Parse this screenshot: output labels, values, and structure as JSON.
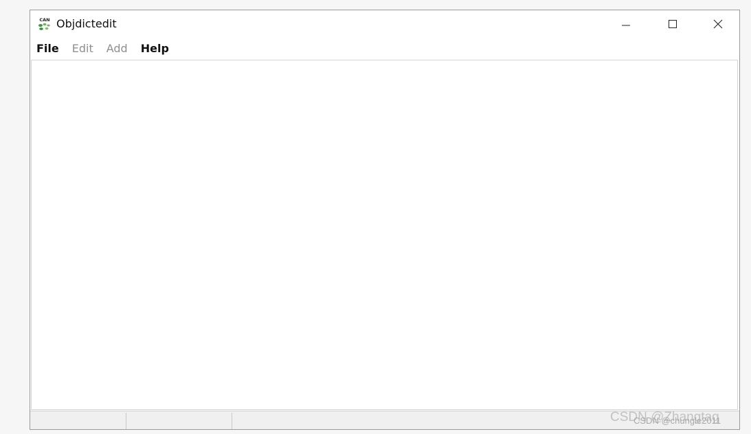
{
  "window": {
    "title": "Objdictedit",
    "icon": "can-icon",
    "icon_text": "CAN",
    "controls": [
      "minimize",
      "maximize",
      "close"
    ]
  },
  "menubar": {
    "items": [
      {
        "label": "File",
        "enabled": true
      },
      {
        "label": "Edit",
        "enabled": false
      },
      {
        "label": "Add",
        "enabled": false
      },
      {
        "label": "Help",
        "enabled": true
      }
    ]
  },
  "watermark": {
    "primary": "CSDN @Zhangtag",
    "secondary": "CSDN @chungle2011"
  }
}
